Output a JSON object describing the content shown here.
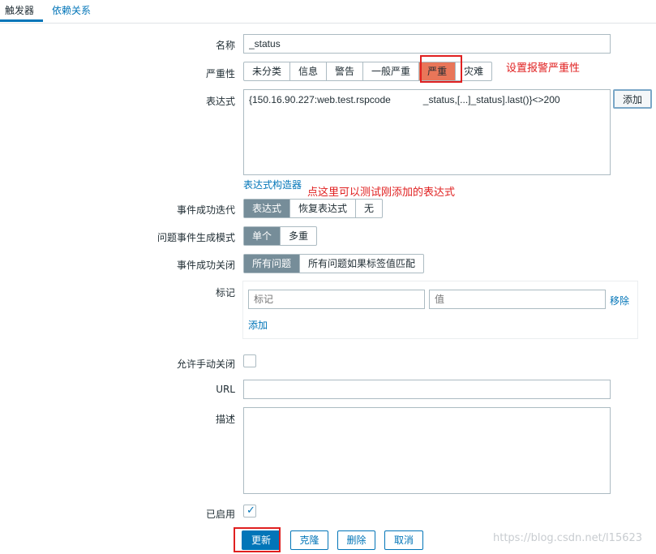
{
  "tabs": {
    "trigger": "触发器",
    "dependencies": "依赖关系"
  },
  "form": {
    "name_label": "名称",
    "name_value": "_status",
    "severity_label": "严重性",
    "severity_options": [
      "未分类",
      "信息",
      "警告",
      "一般严重",
      "严重",
      "灾难"
    ],
    "severity_selected": "严重",
    "severity_annotation": "设置报警严重性",
    "expression_label": "表达式",
    "expression_value": "{150.16.90.227:web.test.rspcode            _status,[...]_status].last()}<>200",
    "add_button": "添加",
    "expression_builder_link": "表达式构造器",
    "expression_builder_annotation": "点这里可以测试刚添加的表达式",
    "ok_event_gen_label": "事件成功迭代",
    "ok_event_gen_options": [
      "表达式",
      "恢复表达式",
      "无"
    ],
    "ok_event_gen_selected": "表达式",
    "problem_mode_label": "问题事件生成模式",
    "problem_mode_options": [
      "单个",
      "多重"
    ],
    "problem_mode_selected": "单个",
    "ok_close_label": "事件成功关闭",
    "ok_close_options": [
      "所有问题",
      "所有问题如果标签值匹配"
    ],
    "ok_close_selected": "所有问题",
    "tags_label": "标记",
    "tag_placeholder": "标记",
    "value_placeholder": "值",
    "remove_link": "移除",
    "add_tag_link": "添加",
    "manual_close_label": "允许手动关闭",
    "manual_close_checked": false,
    "url_label": "URL",
    "url_value": "",
    "description_label": "描述",
    "description_value": "",
    "enabled_label": "已启用",
    "enabled_checked": true
  },
  "actions": {
    "update": "更新",
    "clone": "克隆",
    "delete": "删除",
    "cancel": "取消"
  },
  "watermark": "https://blog.csdn.net/l15623",
  "colors": {
    "accent": "#0275b8",
    "severity_high": "#e97659",
    "selected_gray": "#768d99",
    "annotation_red": "#e02020"
  }
}
